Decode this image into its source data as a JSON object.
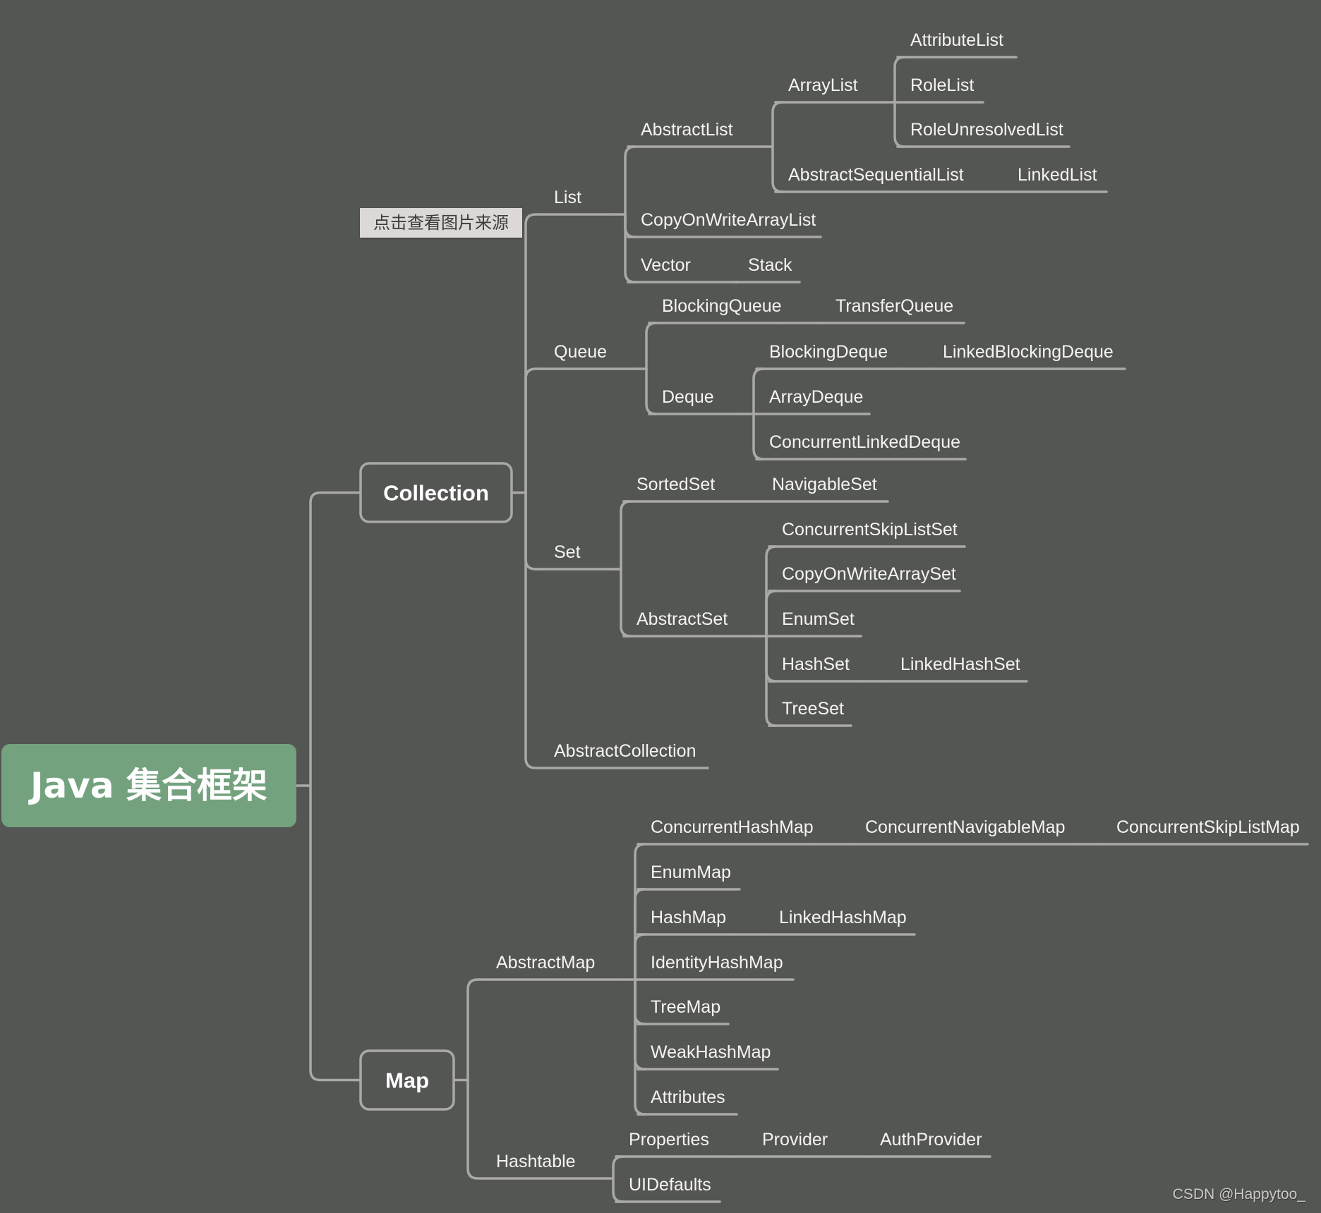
{
  "colors": {
    "background": "#545653",
    "line": "#a9aaa7",
    "root_fill": "#74a27f",
    "text": "#f4f4f2"
  },
  "source_tag": "点击查看图片来源",
  "watermark": "CSDN @Happytoo_",
  "tree": {
    "id": "root",
    "label": "Java 集合框架",
    "children": [
      {
        "id": "collection",
        "label": "Collection",
        "children": [
          {
            "id": "list",
            "label": "List",
            "children": [
              {
                "id": "abstractlist",
                "label": "AbstractList",
                "children": [
                  {
                    "id": "arraylist",
                    "label": "ArrayList",
                    "children": [
                      {
                        "id": "attributelist",
                        "label": "AttributeList"
                      },
                      {
                        "id": "rolelist",
                        "label": "RoleList"
                      },
                      {
                        "id": "roleunresolvedlist",
                        "label": "RoleUnresolvedList"
                      }
                    ]
                  },
                  {
                    "id": "abstractsequentiallist",
                    "label": "AbstractSequentialList",
                    "children": [
                      {
                        "id": "linkedlist",
                        "label": "LinkedList"
                      }
                    ]
                  }
                ]
              },
              {
                "id": "copyonwritearraylist",
                "label": "CopyOnWriteArrayList"
              },
              {
                "id": "vector",
                "label": "Vector",
                "children": [
                  {
                    "id": "stack",
                    "label": "Stack"
                  }
                ]
              }
            ]
          },
          {
            "id": "queue",
            "label": "Queue",
            "children": [
              {
                "id": "blockingqueue",
                "label": "BlockingQueue",
                "children": [
                  {
                    "id": "transferqueue",
                    "label": "TransferQueue"
                  }
                ]
              },
              {
                "id": "deque",
                "label": "Deque",
                "children": [
                  {
                    "id": "blockingdeque",
                    "label": "BlockingDeque",
                    "children": [
                      {
                        "id": "linkedblockingdeque",
                        "label": "LinkedBlockingDeque"
                      }
                    ]
                  },
                  {
                    "id": "arraydeque",
                    "label": "ArrayDeque"
                  },
                  {
                    "id": "concurrentlinkeddeque",
                    "label": "ConcurrentLinkedDeque"
                  }
                ]
              }
            ]
          },
          {
            "id": "set",
            "label": "Set",
            "children": [
              {
                "id": "sortedset",
                "label": "SortedSet",
                "children": [
                  {
                    "id": "navigableset",
                    "label": "NavigableSet"
                  }
                ]
              },
              {
                "id": "abstractset",
                "label": "AbstractSet",
                "children": [
                  {
                    "id": "concurrentskiplistset",
                    "label": "ConcurrentSkipListSet"
                  },
                  {
                    "id": "copyonwritearrayset",
                    "label": "CopyOnWriteArraySet"
                  },
                  {
                    "id": "enumset",
                    "label": "EnumSet"
                  },
                  {
                    "id": "hashset",
                    "label": "HashSet",
                    "children": [
                      {
                        "id": "linkedhashset",
                        "label": "LinkedHashSet"
                      }
                    ]
                  },
                  {
                    "id": "treeset",
                    "label": "TreeSet"
                  }
                ]
              }
            ]
          },
          {
            "id": "abstractcollection",
            "label": "AbstractCollection"
          }
        ]
      },
      {
        "id": "map",
        "label": "Map",
        "children": [
          {
            "id": "abstractmap",
            "label": "AbstractMap",
            "children": [
              {
                "id": "concurrenthashmap",
                "label": "ConcurrentHashMap",
                "children": [
                  {
                    "id": "concurrentnavigablemap",
                    "label": "ConcurrentNavigableMap",
                    "children": [
                      {
                        "id": "concurrentskiplistmap",
                        "label": "ConcurrentSkipListMap"
                      }
                    ]
                  }
                ]
              },
              {
                "id": "enummap",
                "label": "EnumMap"
              },
              {
                "id": "hashmap",
                "label": "HashMap",
                "children": [
                  {
                    "id": "linkedhashmap",
                    "label": "LinkedHashMap"
                  }
                ]
              },
              {
                "id": "identityhashmap",
                "label": "IdentityHashMap"
              },
              {
                "id": "treemap",
                "label": "TreeMap"
              },
              {
                "id": "weakhashmap",
                "label": "WeakHashMap"
              },
              {
                "id": "attributes",
                "label": "Attributes"
              }
            ]
          },
          {
            "id": "hashtable",
            "label": "Hashtable",
            "children": [
              {
                "id": "properties",
                "label": "Properties",
                "children": [
                  {
                    "id": "provider",
                    "label": "Provider",
                    "children": [
                      {
                        "id": "authprovider",
                        "label": "AuthProvider"
                      }
                    ]
                  }
                ]
              },
              {
                "id": "uidefaults",
                "label": "UIDefaults"
              }
            ]
          }
        ]
      }
    ]
  }
}
